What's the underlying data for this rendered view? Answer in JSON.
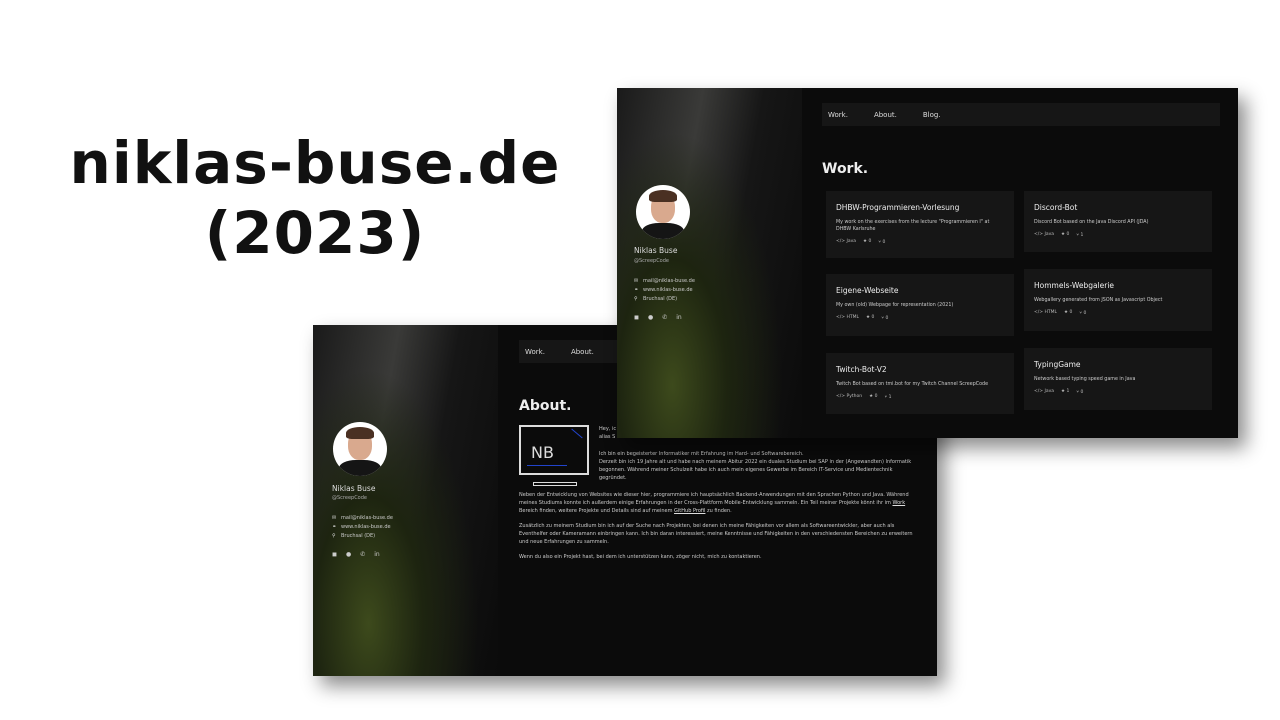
{
  "slide": {
    "title_line1": "niklas-buse.de",
    "title_line2": "(2023)"
  },
  "profile": {
    "name": "Niklas Buse",
    "handle": "@ScreepCode",
    "email": "mail@niklas-buse.de",
    "website": "www.niklas-buse.de",
    "location": "Bruchsal (DE)"
  },
  "nav": {
    "work": "Work.",
    "about": "About.",
    "blog": "Blog."
  },
  "work": {
    "title": "Work.",
    "cards": [
      {
        "title": "DHBW-Programmieren-Vorlesung",
        "desc": "My work on the exercises from the lecture \"Programmieren I\" at DHBW Karlsruhe",
        "lang": "Java",
        "stars": "0",
        "forks": "0"
      },
      {
        "title": "Discord-Bot",
        "desc": "Discord Bot based on the Java Discord API (JDA)",
        "lang": "Java",
        "stars": "0",
        "forks": "1"
      },
      {
        "title": "Eigene-Webseite",
        "desc": "My own (old) Webpage for representation (2021)",
        "lang": "HTML",
        "stars": "0",
        "forks": "0"
      },
      {
        "title": "Hommels-Webgalerie",
        "desc": "Webgallery generated from JSON as Javascript Object",
        "lang": "HTML",
        "stars": "0",
        "forks": "0"
      },
      {
        "title": "Twitch-Bot-V2",
        "desc": "Twitch Bot based on tmi.bot for my Twitch Channel ScreepCode",
        "lang": "Python",
        "stars": "0",
        "forks": "1"
      },
      {
        "title": "TypingGame",
        "desc": "Network based typing speed game in Java",
        "lang": "Java",
        "stars": "1",
        "forks": "0"
      }
    ]
  },
  "about": {
    "title": "About.",
    "logo": "NB",
    "greeting1": "Hey, ic",
    "greeting2": "alias S",
    "p1a": "Ich bin ein begeisterter Informatiker mit Erfahrung im Hard- und Softwarebereich.",
    "p1b": "Derzeit bin ich 19 Jahre alt und habe nach meinem Abitur 2022 ein duales Studium bei SAP in der (Angewandten) Informatik begonnen. Während meiner Schulzeit habe ich auch mein eigenes Gewerbe im Bereich IT-Service und Medientechnik gegründet.",
    "p2a": "Neben der Entwicklung von Websites wie dieser hier, programmiere ich hauptsächlich Backend-Anwendungen mit den Sprachen Python und Java. Während meines Studiums konnte ich außerdem einige Erfahrungen in der Cross-Plattform Mobile-Entwicklung sammeln. Ein Teil meiner Projekte könnt ihr im",
    "p2link1": "Work",
    "p2b": "Bereich finden, weitere Projekte und Details sind auf meinem",
    "p2link2": "GitHub Profil",
    "p2c": "zu finden.",
    "p3": "Zusätzlich zu meinem Studium bin ich auf der Suche nach Projekten, bei denen ich meine Fähigkeiten vor allem als Softwareentwickler, aber auch als Eventhelfer oder Kameramann einbringen kann. Ich bin daran interessiert, meine Kenntnisse und Fähigkeiten in den verschiedensten Bereichen zu erweitern und neue Erfahrungen zu sammeln.",
    "p4": "Wenn du also ein Projekt hast, bei dem ich unterstützen kann, zöger nicht, mich zu kontaktieren."
  }
}
